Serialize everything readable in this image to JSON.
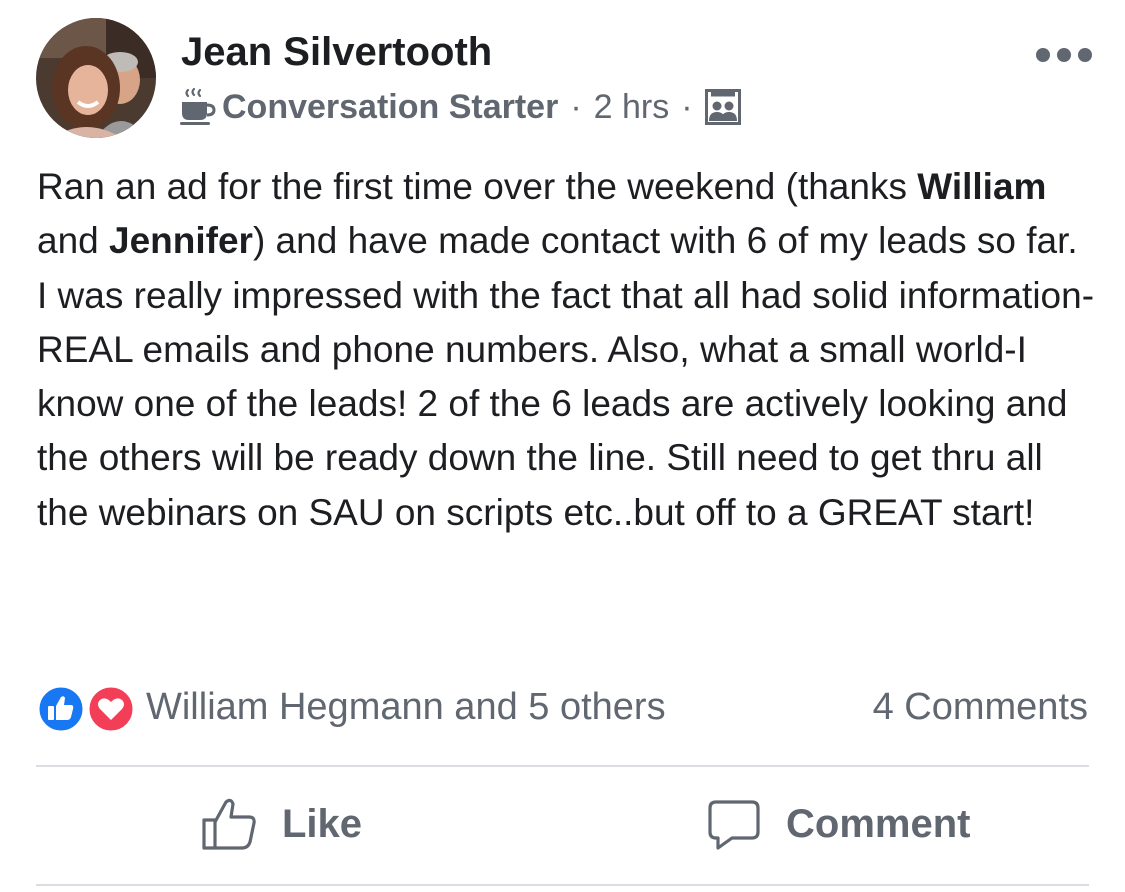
{
  "post": {
    "author": "Jean Silvertooth",
    "badge_icon": "coffee-cup-icon",
    "badge": "Conversation Starter",
    "separator": "·",
    "time": "2 hrs",
    "audience_icon": "group-members-icon",
    "more_icon": "more-options-icon",
    "body": {
      "p1": "Ran an ad for the first time over the weekend (thanks ",
      "mention1": "William",
      "p2": " and ",
      "mention2": "Jennifer",
      "p3": ") and have made contact with 6 of my leads so far.  I was really impressed with the fact that all had solid information-REAL emails and phone numbers.  Also, what a small world-I know one of the leads!  2 of the 6 leads are actively looking and the others will be ready down the line.  Still need to get thru all the webinars on SAU on scripts etc..but off to a GREAT start!"
    }
  },
  "reactions": {
    "icons": [
      "like-reaction-icon",
      "love-reaction-icon"
    ],
    "summary": "William Hegmann and 5 others",
    "comments_count": "4 Comments"
  },
  "actions": {
    "like_icon": "thumbs-up-icon",
    "like_label": "Like",
    "comment_icon": "speech-bubble-icon",
    "comment_label": "Comment"
  },
  "colors": {
    "text_primary": "#1c1e21",
    "text_secondary": "#606770",
    "like_blue": "#1877f2",
    "love_red": "#f33e58",
    "divider": "#dadde1"
  }
}
